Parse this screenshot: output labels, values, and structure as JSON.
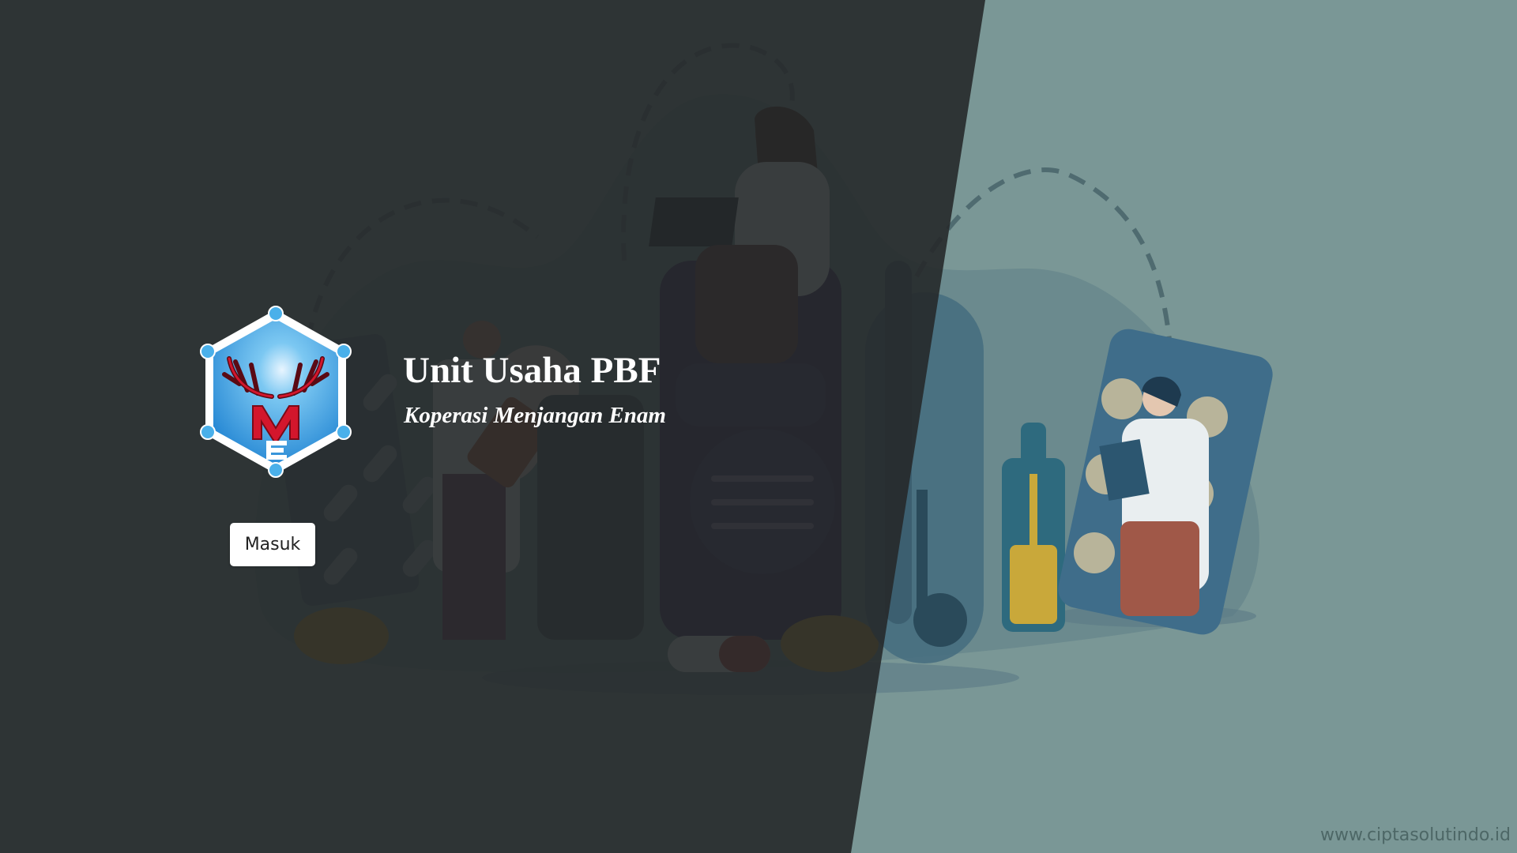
{
  "brand": {
    "title": "Unit Usaha PBF",
    "subtitle": "Koperasi Menjangan Enam"
  },
  "actions": {
    "login_label": "Masuk"
  },
  "footer": {
    "link_text": "www.ciptasolutindo.id"
  },
  "icons": {
    "logo": "koperasi-menjangan-enam-logo"
  },
  "colors": {
    "dark_panel": "#26292a",
    "light_panel": "#7a9796",
    "title_text": "#ffffff",
    "button_bg": "#ffffff",
    "logo_blue": "#2e9be0",
    "logo_red": "#c8102e"
  }
}
